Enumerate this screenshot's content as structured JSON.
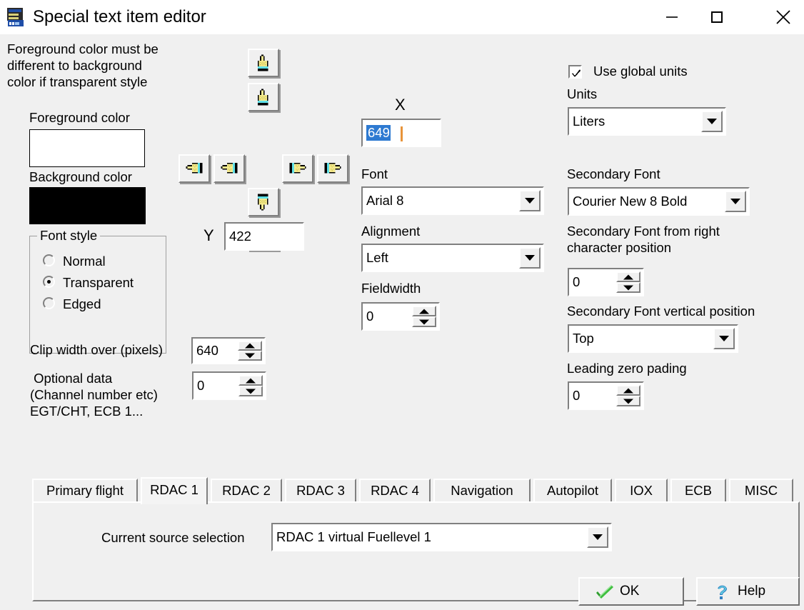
{
  "window": {
    "title": "Special text item editor",
    "icon": "app-editor-icon",
    "minimize_label": "─",
    "maximize_label": "□",
    "close_label": "×"
  },
  "notice": {
    "line1": "Foreground color must be",
    "line2": "different to background",
    "line3": "color if transparent style"
  },
  "colors": {
    "foreground_label": "Foreground color",
    "foreground_value": "#ffffff",
    "background_label": "Background color",
    "background_value": "#000000"
  },
  "font_style": {
    "title": "Font style",
    "options": [
      {
        "label": "Normal",
        "selected": false
      },
      {
        "label": "Transparent",
        "selected": true
      },
      {
        "label": "Edged",
        "selected": false
      }
    ]
  },
  "clip_width": {
    "label": "Clip width over (pixels)",
    "value": "640"
  },
  "optional_data": {
    "label_line1": " Optional data",
    "label_line2": "(Channel number etc)",
    "label_line3": "EGT/CHT, ECB 1...",
    "value": "0"
  },
  "nudge": {
    "up_fast": "move-up-fast-button",
    "up": "move-up-button",
    "left_fast": "move-left-fast-button",
    "left": "move-left-button",
    "right": "move-right-button",
    "right_fast": "move-right-fast-button",
    "down": "move-down-button",
    "down_fast": "move-down-fast-button"
  },
  "position": {
    "x_label": "X",
    "x_value": "649",
    "x_selected": true,
    "y_label": "Y",
    "y_value": "422"
  },
  "font": {
    "label": "Font",
    "value": "Arial 8"
  },
  "alignment": {
    "label": "Alignment",
    "value": "Left"
  },
  "fieldwidth": {
    "label": "Fieldwidth",
    "value": "0"
  },
  "units": {
    "checkbox_label": "Use global units",
    "checkbox_checked": true,
    "label": "Units",
    "value": "Liters"
  },
  "secondary_font": {
    "label": "Secondary Font",
    "value": "Courier New 8 Bold"
  },
  "secondary_from_right": {
    "label_line1": "Secondary Font from right",
    "label_line2": "character position",
    "value": "0"
  },
  "secondary_vertical": {
    "label": "Secondary Font vertical position",
    "value": "Top"
  },
  "leading_zero": {
    "label": "Leading zero pading",
    "value": "0"
  },
  "tabs": [
    {
      "label": "Primary flight",
      "active": false
    },
    {
      "label": "RDAC 1",
      "active": true
    },
    {
      "label": "RDAC 2",
      "active": false
    },
    {
      "label": "RDAC 3",
      "active": false
    },
    {
      "label": "RDAC 4",
      "active": false
    },
    {
      "label": "Navigation",
      "active": false
    },
    {
      "label": "Autopilot",
      "active": false
    },
    {
      "label": "IOX",
      "active": false
    },
    {
      "label": "ECB",
      "active": false
    },
    {
      "label": "MISC",
      "active": false
    }
  ],
  "tab_content": {
    "source_label": "Current source selection",
    "source_value": "RDAC 1 virtual Fuellevel 1"
  },
  "buttons": {
    "ok_label": "OK",
    "help_label": "Help"
  },
  "theme": {
    "face": "#f0f0f0",
    "selection_blue": "#2e7ad1",
    "caret_orange": "#e8943a",
    "shadow": "#808080"
  }
}
